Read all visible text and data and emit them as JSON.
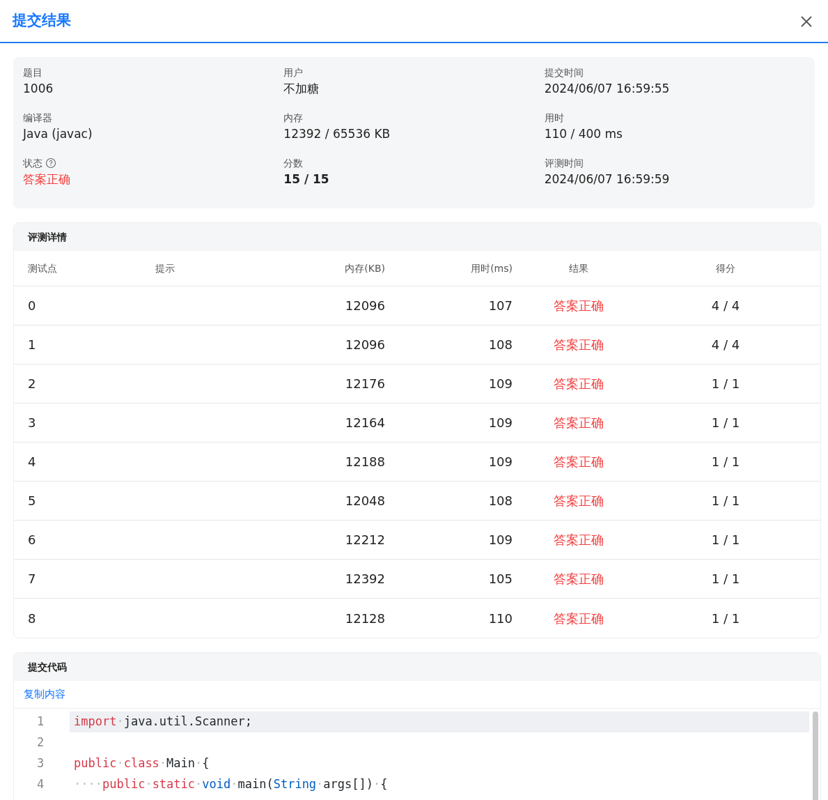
{
  "dialog": {
    "title": "提交结果"
  },
  "info": [
    {
      "label": "题目",
      "value": "1006"
    },
    {
      "label": "用户",
      "value": "不加糖"
    },
    {
      "label": "提交时间",
      "value": "2024/06/07 16:59:55"
    },
    {
      "label": "编译器",
      "value": "Java (javac)"
    },
    {
      "label": "内存",
      "value": "12392 / 65536 KB"
    },
    {
      "label": "用时",
      "value": "110 / 400 ms"
    },
    {
      "label": "状态",
      "value": "答案正确",
      "kind": "status",
      "help": true
    },
    {
      "label": "分数",
      "value": "15 / 15",
      "bold": true
    },
    {
      "label": "评测时间",
      "value": "2024/06/07 16:59:59"
    }
  ],
  "details": {
    "title": "评测详情",
    "columns": [
      "测试点",
      "提示",
      "内存(KB)",
      "用时(ms)",
      "结果",
      "得分"
    ],
    "rows": [
      {
        "case": "0",
        "memory": "12096",
        "time": "107",
        "result": "答案正确",
        "kind": "accepted",
        "score": "4 / 4"
      },
      {
        "case": "1",
        "memory": "12096",
        "time": "108",
        "result": "答案正确",
        "kind": "accepted",
        "score": "4 / 4"
      },
      {
        "case": "2",
        "memory": "12176",
        "time": "109",
        "result": "答案正确",
        "kind": "accepted",
        "score": "1 / 1"
      },
      {
        "case": "3",
        "memory": "12164",
        "time": "109",
        "result": "答案正确",
        "kind": "accepted",
        "score": "1 / 1"
      },
      {
        "case": "4",
        "memory": "12188",
        "time": "109",
        "result": "答案正确",
        "kind": "accepted",
        "score": "1 / 1"
      },
      {
        "case": "5",
        "memory": "12048",
        "time": "108",
        "result": "答案正确",
        "kind": "accepted",
        "score": "1 / 1"
      },
      {
        "case": "6",
        "memory": "12212",
        "time": "109",
        "result": "答案正确",
        "kind": "accepted",
        "score": "1 / 1"
      },
      {
        "case": "7",
        "memory": "12392",
        "time": "105",
        "result": "答案正确",
        "kind": "accepted",
        "score": "1 / 1"
      },
      {
        "case": "8",
        "memory": "12128",
        "time": "110",
        "result": "答案正确",
        "kind": "accepted",
        "score": "1 / 1"
      }
    ]
  },
  "code": {
    "title": "提交代码",
    "copy_link": "复制内容",
    "lines": [
      {
        "number": "1",
        "selected": true,
        "tokens": [
          {
            "kind": "keyword",
            "text": "import"
          },
          {
            "kind": "space",
            "text": "·"
          },
          {
            "kind": "plain",
            "text": "java.util.Scanner;"
          }
        ]
      },
      {
        "number": "2",
        "selected": false
      },
      {
        "number": "3",
        "selected": false,
        "tokens": [
          {
            "kind": "keyword",
            "text": "public"
          },
          {
            "kind": "space",
            "text": "·"
          },
          {
            "kind": "keyword",
            "text": "class"
          },
          {
            "kind": "space",
            "text": "·"
          },
          {
            "kind": "plain",
            "text": "Main"
          },
          {
            "kind": "space",
            "text": "·"
          },
          {
            "kind": "plain",
            "text": "{"
          }
        ]
      },
      {
        "number": "4",
        "selected": false,
        "tokens": [
          {
            "kind": "space",
            "text": "····"
          },
          {
            "kind": "keyword",
            "text": "public"
          },
          {
            "kind": "space",
            "text": "·"
          },
          {
            "kind": "keyword",
            "text": "static"
          },
          {
            "kind": "space",
            "text": "·"
          },
          {
            "kind": "type",
            "text": "void"
          },
          {
            "kind": "space",
            "text": "·"
          },
          {
            "kind": "plain",
            "text": "main("
          },
          {
            "kind": "type",
            "text": "String"
          },
          {
            "kind": "space",
            "text": "·"
          },
          {
            "kind": "plain",
            "text": "args[])"
          },
          {
            "kind": "space",
            "text": "·"
          },
          {
            "kind": "plain",
            "text": "{"
          }
        ]
      }
    ]
  }
}
